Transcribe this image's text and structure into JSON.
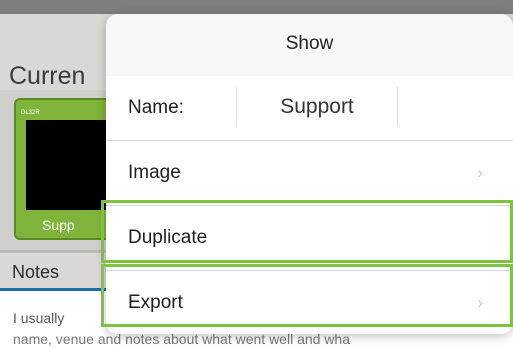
{
  "background": {
    "title": "Curren",
    "tile": {
      "top_label": "DL32R",
      "caption": "Supp"
    },
    "notes": {
      "label": "Notes",
      "line1": "I usually",
      "line2": "name, venue and notes about what went well and wha"
    }
  },
  "popover": {
    "title": "Show",
    "rows": {
      "name_label": "Name:",
      "name_value": "Support",
      "image_label": "Image",
      "duplicate_label": "Duplicate",
      "export_label": "Export"
    },
    "icons": {
      "chevron": "chevron-right-icon"
    }
  },
  "colors": {
    "highlight": "#7ec242",
    "tile_green": "#7fb339",
    "pointer": "#1d6fa8"
  }
}
